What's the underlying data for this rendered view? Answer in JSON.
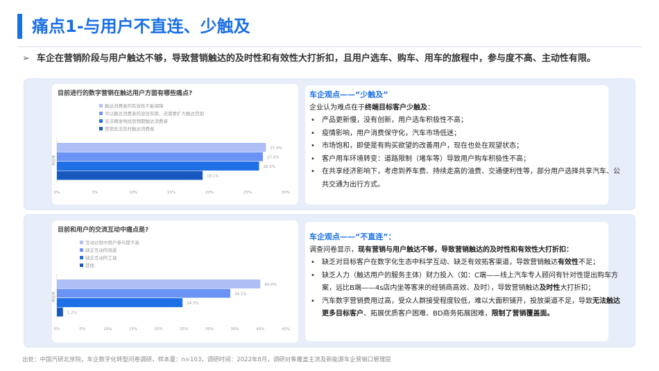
{
  "header": {
    "title": "痛点1-与用户不直连、少触及",
    "subtitle": "车企在营销阶段与用户触达不够，导致营销触达的及时性和有效性大打折扣，且用户选车、购车、用车的旅程中，参与度不高、主动性有限。",
    "bullet_icon": "arrow-right-icon"
  },
  "colors": {
    "accent": "#1a6fe6",
    "series": [
      "#aebff7",
      "#6b93f5",
      "#1f6fe6",
      "#1858bf"
    ]
  },
  "chart_data": [
    {
      "type": "bar",
      "orientation": "horizontal",
      "title": "目前进行的数字营销在触达用户方面有哪些痛点?",
      "ylabel": "响应率",
      "categories": [
        "触达消费者的有效性不能保障",
        "可以触达消费者的途径有限，还需要扩大触达范围",
        "无法精准地找到预期触达消费者",
        "营销无法及时触达消费者"
      ],
      "values": [
        27.4,
        27.0,
        26.5,
        19.1
      ],
      "value_labels": [
        "27.4%",
        "27.0%",
        "26.5%",
        "19.1%"
      ],
      "xlim": [
        0,
        30
      ],
      "ticks": [
        "0%",
        "5%",
        "10%",
        "15%",
        "20%",
        "25%",
        "30%"
      ],
      "legend": "top"
    },
    {
      "type": "bar",
      "orientation": "horizontal",
      "title": "目前和用户的交流互动中痛点是?",
      "ylabel": "响应率",
      "categories": [
        "互动过程中用户参与度不高",
        "缺乏互动的场景",
        "缺乏互动的工具",
        "其他"
      ],
      "values": [
        40.0,
        34.1,
        24.7,
        1.2
      ],
      "value_labels": [
        "40.0%",
        "34.1%",
        "24.7%",
        "1.2%"
      ],
      "xlim": [
        0,
        45
      ],
      "ticks": [
        "0%",
        "5%",
        "10%",
        "15%",
        "20%",
        "25%",
        "30%",
        "35%",
        "40%",
        "45%"
      ],
      "legend": "top"
    }
  ],
  "panel1": {
    "heading": "车企观点——“少触及”",
    "intro_a": "企业认为难点在于",
    "intro_b": "终端目标客户少触及",
    "intro_c": "：",
    "items": [
      "产品更新慢，没有创新，用户选车积极性不高；",
      "疫情影响，用户消费保守化，汽车市场低迷；",
      "市场饱和，即使是有购买欲望的改善用户，现在也处在观望状态；",
      "客户用车环境转变：道路限制（堵车等）导致用户购车积极性不高；",
      "在共享经济影响下，考虑到养车费、持续走高的油费、交通便利性等，部分用户选择共享汽车、公共交通为出行方式。"
    ]
  },
  "panel2": {
    "heading": "车企观点——“不直连”：",
    "intro_a": "调查问卷显示，",
    "intro_b": "现有营销与用户触达不够，导致营销触达的及时性和有效性大打折扣：",
    "i1a": "缺乏对目标客户在数字化生态中科学互动、缺乏有效拓客渠道，导致营销触达",
    "i1b": "有效性",
    "i1c": "不足；",
    "i2a": "缺乏人力（触达用户的服务主体）财力投入（如：C端——线上汽车专人顾问有针对性提出购车方案，远比B端——4s店内坐等客来的经销商高效、及时），导致营销触达",
    "i2b": "及时性",
    "i2c": "大打折扣；",
    "i3a": "汽车数字营销费用过高，受众人群接受程度较低，难以大面积铺开，投放渠道不足，导致",
    "i3b": "无法触达更多目标客户",
    "i3c": "、拓展优质客户困难、BD商务拓展困难，",
    "i3d": "限制了营销覆盖面。"
  },
  "footer": "出处：中国汽研北京院，车企数字化转型问卷调研，样本量：n=103，调研时间：2022年8月，调研对象覆盖主流及新能源车企营销口管理层"
}
